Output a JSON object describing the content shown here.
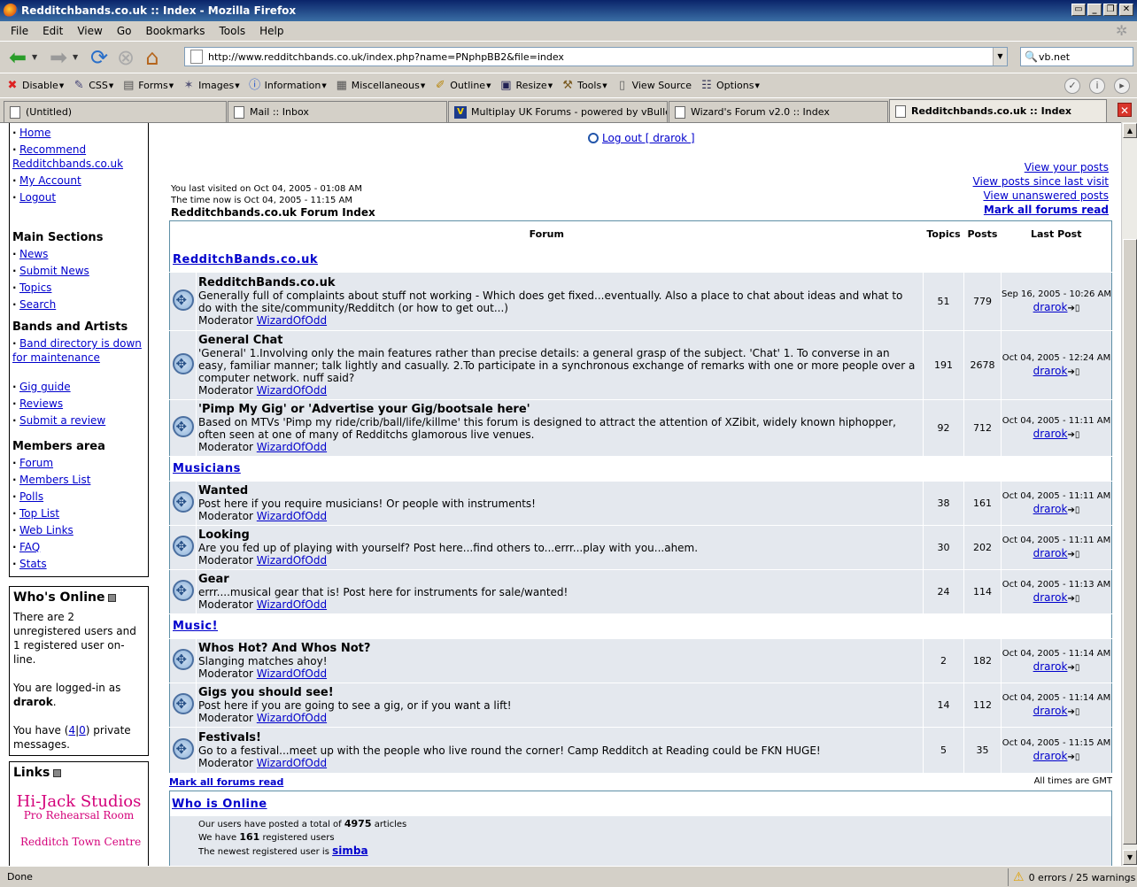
{
  "window": {
    "title": "Redditchbands.co.uk :: Index - Mozilla Firefox"
  },
  "menu": [
    "File",
    "Edit",
    "View",
    "Go",
    "Bookmarks",
    "Tools",
    "Help"
  ],
  "nav": {
    "url": "http://www.redditchbands.co.uk/index.php?name=PNphpBB2&file=index",
    "search_value": "vb.net"
  },
  "devbar": [
    "Disable",
    "CSS",
    "Forms",
    "Images",
    "Information",
    "Miscellaneous",
    "Outline",
    "Resize",
    "Tools",
    "View Source",
    "Options"
  ],
  "tabs": [
    "(Untitled)",
    "Mail :: Inbox",
    "Multiplay UK Forums - powered by vBulletin",
    "Wizard's Forum v2.0 :: Index",
    "Redditchbands.co.uk :: Index"
  ],
  "sidebar": {
    "top_items": [
      "Home",
      "Recommend Redditchbands.co.uk",
      "My Account",
      "Logout"
    ],
    "main_title": "Main Sections",
    "main_items": [
      "News",
      "Submit News",
      "Topics",
      "Search"
    ],
    "bands_title": "Bands and Artists",
    "bands_items": [
      "Band directory is down for maintenance"
    ],
    "bands_items2": [
      "Gig guide",
      "Reviews",
      "Submit a review"
    ],
    "members_title": "Members area",
    "members_items": [
      "Forum",
      "Members List",
      "Polls",
      "Top List",
      "Web Links",
      "FAQ",
      "Stats"
    ],
    "whos_online": {
      "title": "Who's Online",
      "line1": "There are 2 unregistered users and 1 registered user on-line.",
      "line2_pre": "You are logged-in as",
      "user": "drarok",
      "line3_pre": "You have (",
      "pm1": "4",
      "pm_sep": "|",
      "pm2": "0",
      "line3_post": ") private messages."
    },
    "links": {
      "title": "Links",
      "logo_line1": "Hi-Jack Studios",
      "logo_line2": "Pro Rehearsal Room",
      "logo_line3": "Redditch Town Centre"
    }
  },
  "forum": {
    "logout": "Log out [ drarok ]",
    "last_visit": "You last visited on Oct 04, 2005 - 01:08 AM",
    "time_now": "The time now is Oct 04, 2005 - 11:15 AM",
    "index_title": "Redditchbands.co.uk Forum Index",
    "links": [
      "View your posts",
      "View posts since last visit",
      "View unanswered posts",
      "Mark all forums read"
    ],
    "headers": {
      "forum": "Forum",
      "topics": "Topics",
      "posts": "Posts",
      "last": "Last Post"
    },
    "moderator_label": "Moderator",
    "categories": [
      {
        "name": "RedditchBands.co.uk",
        "forums": [
          {
            "name": "RedditchBands.co.uk",
            "desc": "Generally full of complaints about stuff not working - Which does get fixed...eventually. Also a place to chat about ideas and what to do with the site/community/Redditch (or how to get out...)",
            "moderator": "WizardOfOdd",
            "topics": "51",
            "posts": "779",
            "last_date": "Sep 16, 2005 - 10:26 AM",
            "last_user": "drarok"
          },
          {
            "name": "General Chat",
            "desc": "'General' 1.Involving only the main features rather than precise details: a general grasp of the subject. 'Chat' 1. To converse in an easy, familiar manner; talk lightly and casually. 2.To participate in a synchronous exchange of remarks with one or more people over a computer network. nuff said?",
            "moderator": "WizardOfOdd",
            "topics": "191",
            "posts": "2678",
            "last_date": "Oct 04, 2005 - 12:24 AM",
            "last_user": "drarok"
          },
          {
            "name": "'Pimp My Gig' or 'Advertise your Gig/bootsale here'",
            "desc": "Based on MTVs 'Pimp my ride/crib/ball/life/killme' this forum is designed to attract the attention of XZibit, widely known hiphopper, often seen at one of many of Redditchs glamorous live venues.",
            "moderator": "WizardOfOdd",
            "topics": "92",
            "posts": "712",
            "last_date": "Oct 04, 2005 - 11:11 AM",
            "last_user": "drarok"
          }
        ]
      },
      {
        "name": "Musicians",
        "forums": [
          {
            "name": "Wanted",
            "desc": "Post here if you require musicians! Or people with instruments!",
            "moderator": "WizardOfOdd",
            "topics": "38",
            "posts": "161",
            "last_date": "Oct 04, 2005 - 11:11 AM",
            "last_user": "drarok"
          },
          {
            "name": "Looking",
            "desc": "Are you fed up of playing with yourself? Post here...find others to...errr...play with you...ahem.",
            "moderator": "WizardOfOdd",
            "topics": "30",
            "posts": "202",
            "last_date": "Oct 04, 2005 - 11:11 AM",
            "last_user": "drarok"
          },
          {
            "name": "Gear",
            "desc": "errr....musical gear that is! Post here for instruments for sale/wanted!",
            "moderator": "WizardOfOdd",
            "topics": "24",
            "posts": "114",
            "last_date": "Oct 04, 2005 - 11:13 AM",
            "last_user": "drarok"
          }
        ]
      },
      {
        "name": "Music!",
        "forums": [
          {
            "name": "Whos Hot? And Whos Not?",
            "desc": "Slanging matches ahoy!",
            "moderator": "WizardOfOdd",
            "topics": "2",
            "posts": "182",
            "last_date": "Oct 04, 2005 - 11:14 AM",
            "last_user": "drarok"
          },
          {
            "name": "Gigs you should see!",
            "desc": "Post here if you are going to see a gig, or if you want a lift!",
            "moderator": "WizardOfOdd",
            "topics": "14",
            "posts": "112",
            "last_date": "Oct 04, 2005 - 11:14 AM",
            "last_user": "drarok"
          },
          {
            "name": "Festivals!",
            "desc": "Go to a festival...meet up with the people who live round the corner! Camp Redditch at Reading could be FKN HUGE!",
            "moderator": "WizardOfOdd",
            "topics": "5",
            "posts": "35",
            "last_date": "Oct 04, 2005 - 11:15 AM",
            "last_user": "drarok"
          }
        ]
      }
    ],
    "mark_all": "Mark all forums read",
    "times_note": "All times are GMT",
    "who_title": "Who is Online",
    "who_line1_pre": "Our users have posted a total of",
    "who_articles": "4975",
    "who_line1_post": "articles",
    "who_line2_pre": "We have",
    "who_registered": "161",
    "who_line2_post": "registered users",
    "who_line3_pre": "The newest registered user is",
    "who_newest": "simba"
  },
  "status": {
    "text": "Done",
    "errors": "0 errors / 25 warnings"
  }
}
